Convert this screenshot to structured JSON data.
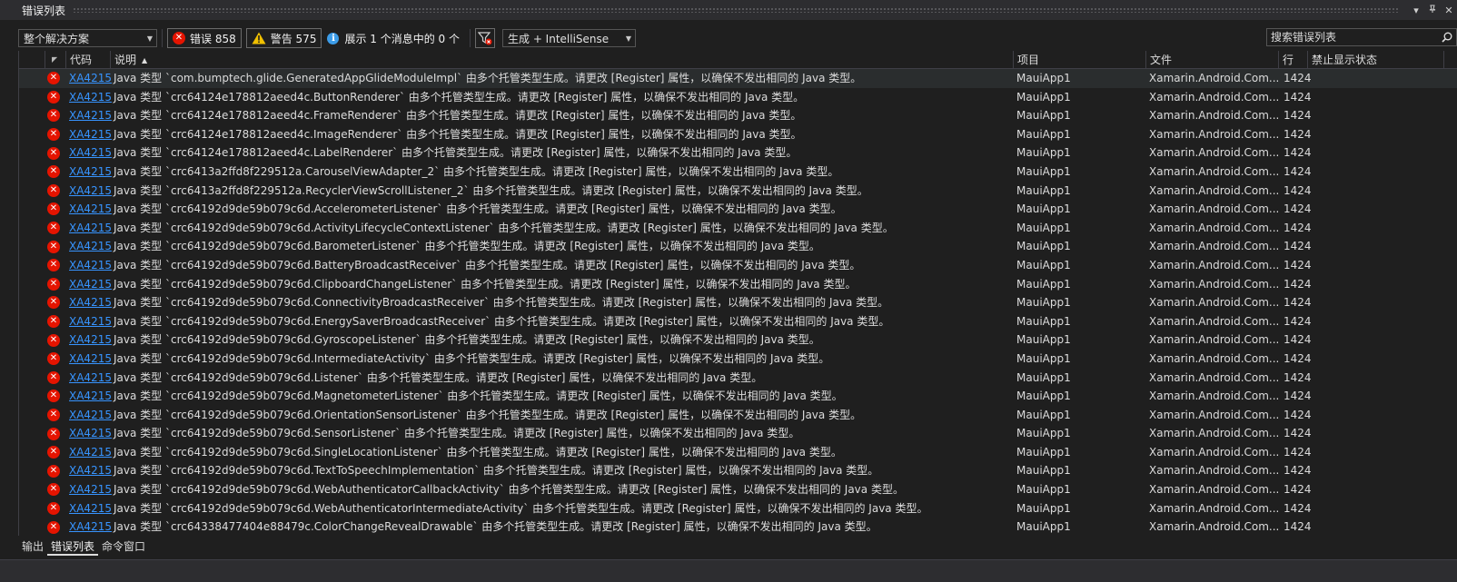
{
  "panel": {
    "title": "错误列表",
    "menu_glyph": "▾",
    "pin_glyph": "✕"
  },
  "toolbar": {
    "scope_dropdown": {
      "selected": "整个解决方案"
    },
    "errors_button": {
      "label": "错误 858"
    },
    "warnings_button": {
      "label": "警告 575"
    },
    "messages_filter": {
      "label": "展示 1 个消息中的 0 个"
    },
    "build_dropdown": {
      "selected": "生成 + IntelliSense"
    }
  },
  "search": {
    "placeholder": "搜索错误列表"
  },
  "columns": {
    "code": "代码",
    "description": "说明",
    "project": "项目",
    "file": "文件",
    "line": "行",
    "suppression": "禁止显示状态"
  },
  "rows": [
    {
      "severity": "error",
      "code": "XA4215",
      "description": "Java 类型 `com.bumptech.glide.GeneratedAppGlideModuleImpl` 由多个托管类型生成。请更改 [Register] 属性，以确保不发出相同的 Java 类型。",
      "project": "MauiApp1",
      "file": "Xamarin.Android.Com...",
      "line": "1424"
    },
    {
      "severity": "error",
      "code": "XA4215",
      "description": "Java 类型 `crc64124e178812aeed4c.ButtonRenderer` 由多个托管类型生成。请更改 [Register] 属性，以确保不发出相同的 Java 类型。",
      "project": "MauiApp1",
      "file": "Xamarin.Android.Com...",
      "line": "1424"
    },
    {
      "severity": "error",
      "code": "XA4215",
      "description": "Java 类型 `crc64124e178812aeed4c.FrameRenderer` 由多个托管类型生成。请更改 [Register] 属性，以确保不发出相同的 Java 类型。",
      "project": "MauiApp1",
      "file": "Xamarin.Android.Com...",
      "line": "1424"
    },
    {
      "severity": "error",
      "code": "XA4215",
      "description": "Java 类型 `crc64124e178812aeed4c.ImageRenderer` 由多个托管类型生成。请更改 [Register] 属性，以确保不发出相同的 Java 类型。",
      "project": "MauiApp1",
      "file": "Xamarin.Android.Com...",
      "line": "1424"
    },
    {
      "severity": "error",
      "code": "XA4215",
      "description": "Java 类型 `crc64124e178812aeed4c.LabelRenderer` 由多个托管类型生成。请更改 [Register] 属性，以确保不发出相同的 Java 类型。",
      "project": "MauiApp1",
      "file": "Xamarin.Android.Com...",
      "line": "1424"
    },
    {
      "severity": "error",
      "code": "XA4215",
      "description": "Java 类型 `crc6413a2ffd8f229512a.CarouselViewAdapter_2` 由多个托管类型生成。请更改 [Register] 属性，以确保不发出相同的 Java 类型。",
      "project": "MauiApp1",
      "file": "Xamarin.Android.Com...",
      "line": "1424"
    },
    {
      "severity": "error",
      "code": "XA4215",
      "description": "Java 类型 `crc6413a2ffd8f229512a.RecyclerViewScrollListener_2` 由多个托管类型生成。请更改 [Register] 属性，以确保不发出相同的 Java 类型。",
      "project": "MauiApp1",
      "file": "Xamarin.Android.Com...",
      "line": "1424"
    },
    {
      "severity": "error",
      "code": "XA4215",
      "description": "Java 类型 `crc64192d9de59b079c6d.AccelerometerListener` 由多个托管类型生成。请更改 [Register] 属性，以确保不发出相同的 Java 类型。",
      "project": "MauiApp1",
      "file": "Xamarin.Android.Com...",
      "line": "1424"
    },
    {
      "severity": "error",
      "code": "XA4215",
      "description": "Java 类型 `crc64192d9de59b079c6d.ActivityLifecycleContextListener` 由多个托管类型生成。请更改 [Register] 属性，以确保不发出相同的 Java 类型。",
      "project": "MauiApp1",
      "file": "Xamarin.Android.Com...",
      "line": "1424"
    },
    {
      "severity": "error",
      "code": "XA4215",
      "description": "Java 类型 `crc64192d9de59b079c6d.BarometerListener` 由多个托管类型生成。请更改 [Register] 属性，以确保不发出相同的 Java 类型。",
      "project": "MauiApp1",
      "file": "Xamarin.Android.Com...",
      "line": "1424"
    },
    {
      "severity": "error",
      "code": "XA4215",
      "description": "Java 类型 `crc64192d9de59b079c6d.BatteryBroadcastReceiver` 由多个托管类型生成。请更改 [Register] 属性，以确保不发出相同的 Java 类型。",
      "project": "MauiApp1",
      "file": "Xamarin.Android.Com...",
      "line": "1424"
    },
    {
      "severity": "error",
      "code": "XA4215",
      "description": "Java 类型 `crc64192d9de59b079c6d.ClipboardChangeListener` 由多个托管类型生成。请更改 [Register] 属性，以确保不发出相同的 Java 类型。",
      "project": "MauiApp1",
      "file": "Xamarin.Android.Com...",
      "line": "1424"
    },
    {
      "severity": "error",
      "code": "XA4215",
      "description": "Java 类型 `crc64192d9de59b079c6d.ConnectivityBroadcastReceiver` 由多个托管类型生成。请更改 [Register] 属性，以确保不发出相同的 Java 类型。",
      "project": "MauiApp1",
      "file": "Xamarin.Android.Com...",
      "line": "1424"
    },
    {
      "severity": "error",
      "code": "XA4215",
      "description": "Java 类型 `crc64192d9de59b079c6d.EnergySaverBroadcastReceiver` 由多个托管类型生成。请更改 [Register] 属性，以确保不发出相同的 Java 类型。",
      "project": "MauiApp1",
      "file": "Xamarin.Android.Com...",
      "line": "1424"
    },
    {
      "severity": "error",
      "code": "XA4215",
      "description": "Java 类型 `crc64192d9de59b079c6d.GyroscopeListener` 由多个托管类型生成。请更改 [Register] 属性，以确保不发出相同的 Java 类型。",
      "project": "MauiApp1",
      "file": "Xamarin.Android.Com...",
      "line": "1424"
    },
    {
      "severity": "error",
      "code": "XA4215",
      "description": "Java 类型 `crc64192d9de59b079c6d.IntermediateActivity` 由多个托管类型生成。请更改 [Register] 属性，以确保不发出相同的 Java 类型。",
      "project": "MauiApp1",
      "file": "Xamarin.Android.Com...",
      "line": "1424"
    },
    {
      "severity": "error",
      "code": "XA4215",
      "description": "Java 类型 `crc64192d9de59b079c6d.Listener` 由多个托管类型生成。请更改 [Register] 属性，以确保不发出相同的 Java 类型。",
      "project": "MauiApp1",
      "file": "Xamarin.Android.Com...",
      "line": "1424"
    },
    {
      "severity": "error",
      "code": "XA4215",
      "description": "Java 类型 `crc64192d9de59b079c6d.MagnetometerListener` 由多个托管类型生成。请更改 [Register] 属性，以确保不发出相同的 Java 类型。",
      "project": "MauiApp1",
      "file": "Xamarin.Android.Com...",
      "line": "1424"
    },
    {
      "severity": "error",
      "code": "XA4215",
      "description": "Java 类型 `crc64192d9de59b079c6d.OrientationSensorListener` 由多个托管类型生成。请更改 [Register] 属性，以确保不发出相同的 Java 类型。",
      "project": "MauiApp1",
      "file": "Xamarin.Android.Com...",
      "line": "1424"
    },
    {
      "severity": "error",
      "code": "XA4215",
      "description": "Java 类型 `crc64192d9de59b079c6d.SensorListener` 由多个托管类型生成。请更改 [Register] 属性，以确保不发出相同的 Java 类型。",
      "project": "MauiApp1",
      "file": "Xamarin.Android.Com...",
      "line": "1424"
    },
    {
      "severity": "error",
      "code": "XA4215",
      "description": "Java 类型 `crc64192d9de59b079c6d.SingleLocationListener` 由多个托管类型生成。请更改 [Register] 属性，以确保不发出相同的 Java 类型。",
      "project": "MauiApp1",
      "file": "Xamarin.Android.Com...",
      "line": "1424"
    },
    {
      "severity": "error",
      "code": "XA4215",
      "description": "Java 类型 `crc64192d9de59b079c6d.TextToSpeechImplementation` 由多个托管类型生成。请更改 [Register] 属性，以确保不发出相同的 Java 类型。",
      "project": "MauiApp1",
      "file": "Xamarin.Android.Com...",
      "line": "1424"
    },
    {
      "severity": "error",
      "code": "XA4215",
      "description": "Java 类型 `crc64192d9de59b079c6d.WebAuthenticatorCallbackActivity` 由多个托管类型生成。请更改 [Register] 属性，以确保不发出相同的 Java 类型。",
      "project": "MauiApp1",
      "file": "Xamarin.Android.Com...",
      "line": "1424"
    },
    {
      "severity": "error",
      "code": "XA4215",
      "description": "Java 类型 `crc64192d9de59b079c6d.WebAuthenticatorIntermediateActivity` 由多个托管类型生成。请更改 [Register] 属性，以确保不发出相同的 Java 类型。",
      "project": "MauiApp1",
      "file": "Xamarin.Android.Com...",
      "line": "1424"
    },
    {
      "severity": "error",
      "code": "XA4215",
      "description": "Java 类型 `crc64338477404e88479c.ColorChangeRevealDrawable` 由多个托管类型生成。请更改 [Register] 属性，以确保不发出相同的 Java 类型。",
      "project": "MauiApp1",
      "file": "Xamarin.Android.Com...",
      "line": "1424"
    }
  ],
  "bottom_tabs": [
    {
      "label": "输出",
      "active": false
    },
    {
      "label": "错误列表",
      "active": true
    },
    {
      "label": "命令窗口",
      "active": false
    }
  ],
  "colors": {
    "background": "#1f1f1f",
    "error_red": "#e51400",
    "warning_yellow": "#f0c000",
    "info_blue": "#3c9ce8",
    "link_blue": "#3794ff"
  }
}
